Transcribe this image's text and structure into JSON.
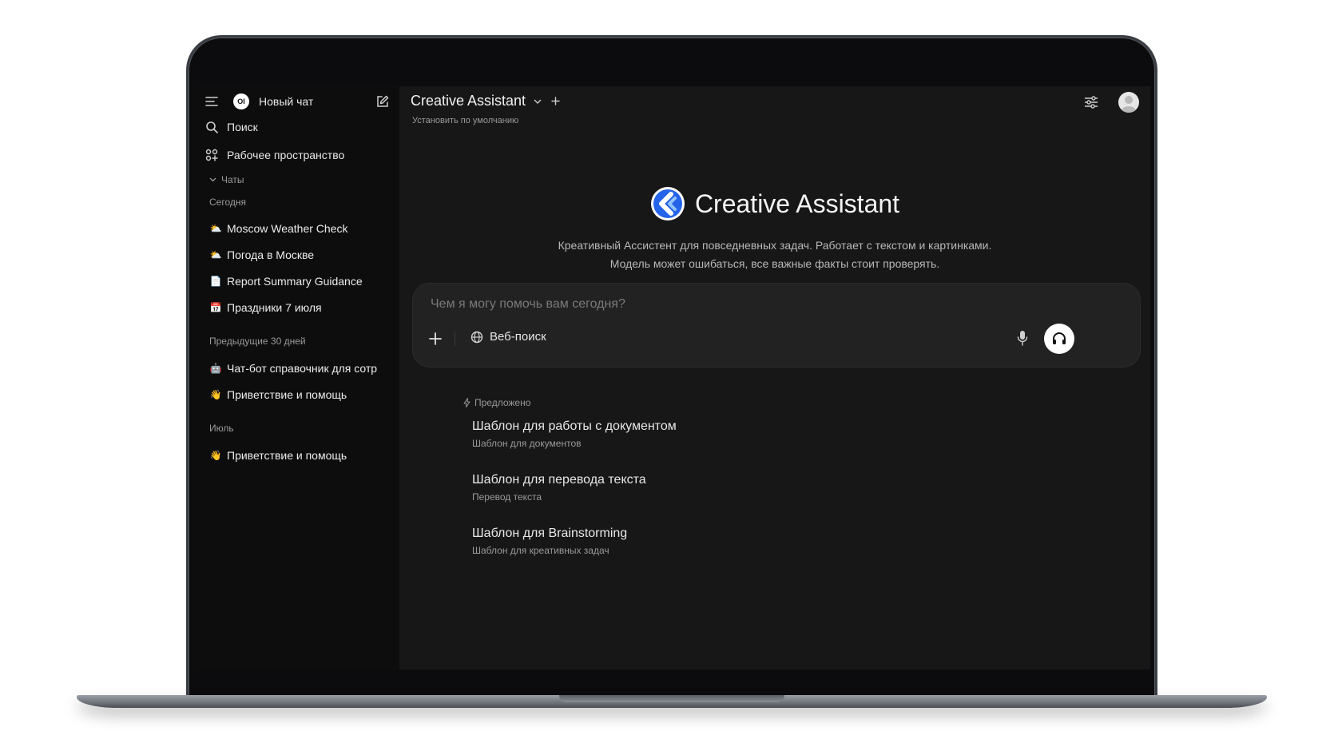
{
  "sidebar": {
    "new_chat_label": "Новый чат",
    "logo_text": "OI",
    "search_label": "Поиск",
    "workspace_label": "Рабочее пространство",
    "chats_label": "Чаты",
    "groups": [
      {
        "label": "Сегодня",
        "items": [
          {
            "emoji": "⛅",
            "label": "Moscow Weather Check"
          },
          {
            "emoji": "⛅",
            "label": "Погода в Москве"
          },
          {
            "emoji": "📄",
            "label": "Report Summary Guidance"
          },
          {
            "emoji": "📅",
            "label": "Праздники 7 июля"
          }
        ]
      },
      {
        "label": "Предыдущие 30 дней",
        "items": [
          {
            "emoji": "🤖",
            "label": "Чат-бот справочник для сотр"
          },
          {
            "emoji": "👋",
            "label": "Приветствие и помощь"
          }
        ]
      },
      {
        "label": "Июль",
        "items": [
          {
            "emoji": "👋",
            "label": "Приветствие и помощь"
          }
        ]
      }
    ]
  },
  "header": {
    "model_name": "Creative Assistant",
    "set_default_label": "Установить по умолчанию"
  },
  "hero": {
    "title": "Creative Assistant",
    "desc_line1": "Креативный Ассистент для повседневных задач. Работает с текстом и картинками.",
    "desc_line2": "Модель может ошибаться, все важные факты стоит проверять."
  },
  "composer": {
    "placeholder": "Чем я могу помочь вам сегодня?",
    "web_search_label": "Веб-поиск"
  },
  "suggestions": {
    "header": "Предложено",
    "items": [
      {
        "title": "Шаблон для работы с документом",
        "subtitle": "Шаблон для документов"
      },
      {
        "title": "Шаблон для перевода текста",
        "subtitle": "Перевод текста"
      },
      {
        "title": "Шаблон для Brainstorming",
        "subtitle": "Шаблон для креативных задач"
      }
    ]
  },
  "colors": {
    "sidebar_bg": "#0d0d0d",
    "main_bg": "#171717",
    "composer_bg": "#222222",
    "logo_blue": "#3b82f6"
  }
}
